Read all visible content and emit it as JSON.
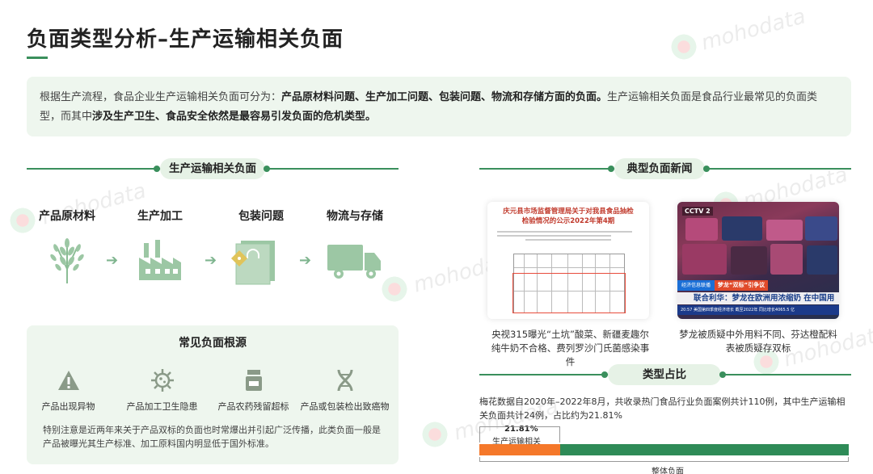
{
  "title": "负面类型分析–生产运输相关负面",
  "watermark_text": "mohodata",
  "intro": {
    "p1": "根据生产流程，食品企业生产运输相关负面可分为：",
    "b1": "产品原材料问题、生产加工问题、包装问题、物流和存储方面的负面。",
    "p2": "生产运输相关负面是食品行业最常见的负面类型，而其中",
    "b2": "涉及生产卫生、食品安全依然是最容易引发负面的危机类型。"
  },
  "left_section": {
    "title": "生产运输相关负面",
    "stages": [
      {
        "label": "产品原材料",
        "icon": "wheat-icon"
      },
      {
        "label": "生产加工",
        "icon": "factory-icon"
      },
      {
        "label": "包装问题",
        "icon": "package-bag-icon"
      },
      {
        "label": "物流与存储",
        "icon": "delivery-truck-icon"
      }
    ]
  },
  "roots": {
    "title": "常见负面根源",
    "items": [
      {
        "label": "产品出现异物",
        "icon": "warning-triangle-icon"
      },
      {
        "label": "产品加工卫生隐患",
        "icon": "virus-icon"
      },
      {
        "label": "产品农药残留超标",
        "icon": "pesticide-bottle-icon"
      },
      {
        "label": "产品或包装检出致癌物",
        "icon": "dna-icon"
      }
    ],
    "note": "特别注意是近两年来关于产品双标的负面也时常爆出并引起广泛传播，此类负面一般是产品被曝光其生产标准、加工原料国内明显低于国外标准。"
  },
  "news_section": {
    "title": "典型负面新闻",
    "items": [
      {
        "caption": "央视315曝光“土坑”酸菜、新疆麦趣尔纯牛奶不合格、费列罗沙门氏菌感染事件",
        "doc_title": "庆元县市场监督管理局关于对我县食品抽检检验情况的公示2022年第4期"
      },
      {
        "caption": "梦龙被质疑中外用料不同、芬达橙配料表被质疑存双标",
        "tv_logo": "CCTV 2",
        "tv_tag": "梦龙“双标”引争议",
        "tv_tag_left": "经济信息联播",
        "tv_headline": "联合利华：梦龙在欧洲用浓缩奶 在中国用复原奶",
        "tv_ticker": "20:57 美国第四季度经济增长 截至2022年 同比增长4065.5 亿"
      }
    ]
  },
  "ratio_section": {
    "title": "类型占比",
    "text": "梅花数据自2020年–2022年8月，共收录热门食品行业负面案例共计110例，其中生产运输相关负面共计24例，占比约为21.81%",
    "chart_data": {
      "type": "bar",
      "categories": [
        "生产运输相关",
        "整体负面"
      ],
      "values": [
        24,
        110
      ],
      "percent_label": "21.81%",
      "segment_label": "生产运输相关",
      "total_label": "整体负面",
      "share": 0.2181
    }
  },
  "colors": {
    "accent": "#3a8f5c",
    "orange": "#f5782a",
    "green_bar": "#2e8b57",
    "panel_bg": "#eef6ee"
  }
}
